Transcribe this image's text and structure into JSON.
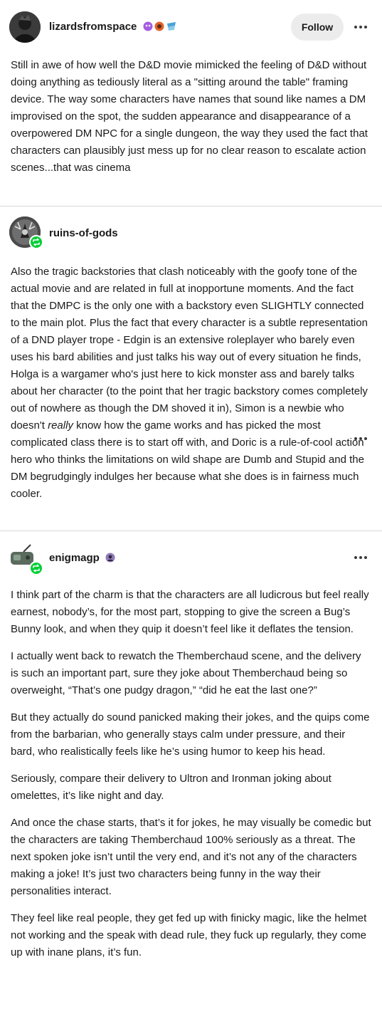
{
  "posts": [
    {
      "username": "lizardsfromspace",
      "follow_label": "Follow",
      "paragraphs": [
        "Still in awe of how well the D&D movie mimicked the feeling of D&D without doing anything as tediously literal as a \"sitting around the table\" framing device. The way some characters have names that sound like names a DM improvised on the spot, the sudden appearance and disappearance of a overpowered DM NPC for a single dungeon, the way they used the fact that characters can plausibly just mess up for no clear reason to escalate action scenes...that was cinema"
      ]
    },
    {
      "username": "ruins-of-gods",
      "paragraphs": [
        {
          "before": "Also the tragic backstories that clash noticeably with the goofy tone of the actual movie and are related in full at inopportune moments. And the fact that the DMPC is the only one with a backstory even SLIGHTLY connected to the main plot. Plus the fact that every character is a subtle representation of a DND player trope - Edgin is an extensive roleplayer who barely even uses his bard abilities and just talks his way out of every situation he finds, Holga is a wargamer who's just here to kick monster ass and barely talks about her character (to the point that her tragic backstory comes completely out of nowhere as though the DM shoved it in), Simon is a newbie who doesn't ",
          "italic": "really",
          "after": " know how the game works and has picked the most complicated class there is to start off with, and Doric is a rule-of-cool action hero who thinks the limitations on wild shape are Dumb and Stupid and the DM begrudgingly indulges her because what she does is in fairness much cooler."
        }
      ]
    },
    {
      "username": "enigmagp",
      "paragraphs": [
        "I think part of the charm is that the characters are all ludicrous but feel really earnest, nobody’s, for the most part, stopping to give the screen a Bug’s Bunny look, and when they quip it doesn’t feel like it deflates the tension.",
        "I actually went back to rewatch the Themberchaud scene, and the delivery is such an important part, sure they joke about Themberchaud being so overweight, “That’s one pudgy dragon,” “did he eat the last one?”",
        "But they actually do sound panicked making their jokes, and the quips come from the barbarian, who generally stays calm under pressure, and their bard, who realistically feels like he’s using humor to keep his head.",
        "Seriously, compare their delivery to Ultron and Ironman joking about omelettes, it’s like night and day.",
        "And once the chase starts, that’s it for jokes, he may visually be comedic but the characters are taking Themberchaud 100% seriously as a threat. The next spoken joke isn’t until the very end, and it’s not any of the characters making a joke! It’s just two characters being funny in the way their personalities interact.",
        "They feel like real people, they get fed up with finicky magic, like the helmet not working and the speak with dead rule, they fuck up regularly, they come up with inane plans, it’s fun."
      ]
    }
  ],
  "colors": {
    "reblog_green": "#00cf35",
    "badge_purple": "#a65ce0",
    "badge_orange": "#e0632b",
    "badge_blue": "#4aa3d6",
    "divider": "#d9d9d9"
  },
  "icons": [
    "more-options-icon",
    "reblog-icon",
    "blog-badge-icon"
  ]
}
